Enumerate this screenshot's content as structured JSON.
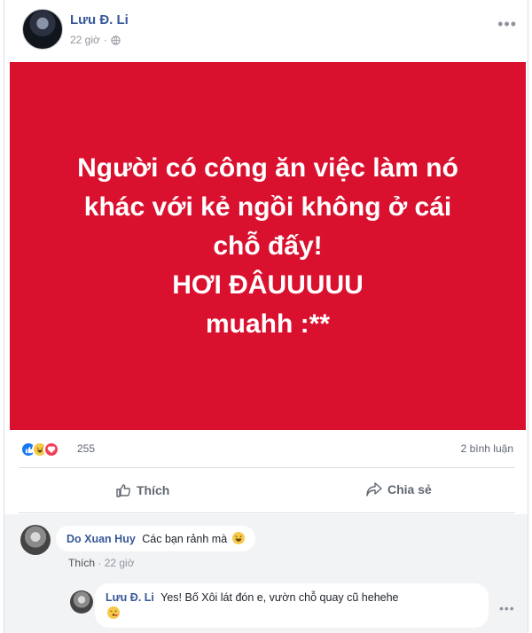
{
  "post": {
    "author": "Lưu Đ. Li",
    "time": "22 giờ",
    "privacy_icon": "globe-icon",
    "more_icon": "more-options-icon",
    "card": {
      "background": "#d9112f",
      "lines": [
        "Người có công ăn việc làm nó",
        "khác với kẻ ngồi không ở cái",
        "chỗ đấy!",
        "HƠI ĐÂUUUUU",
        "muahh :**"
      ]
    },
    "reactions": {
      "icons": [
        "like-icon",
        "haha-icon",
        "love-icon"
      ],
      "count": "255",
      "comments": "2 bình luận"
    },
    "actions": {
      "like": "Thích",
      "share": "Chia sẻ"
    }
  },
  "comments": [
    {
      "author": "Do Xuan Huy",
      "text": "Các bạn rảnh mà",
      "like": "Thích",
      "separator": "·",
      "time": "22 giờ"
    },
    {
      "author": "Lưu Đ. Li",
      "text": "Yes! Bố Xôi lát đón e, vườn chỗ quay cũ hehehe"
    }
  ]
}
